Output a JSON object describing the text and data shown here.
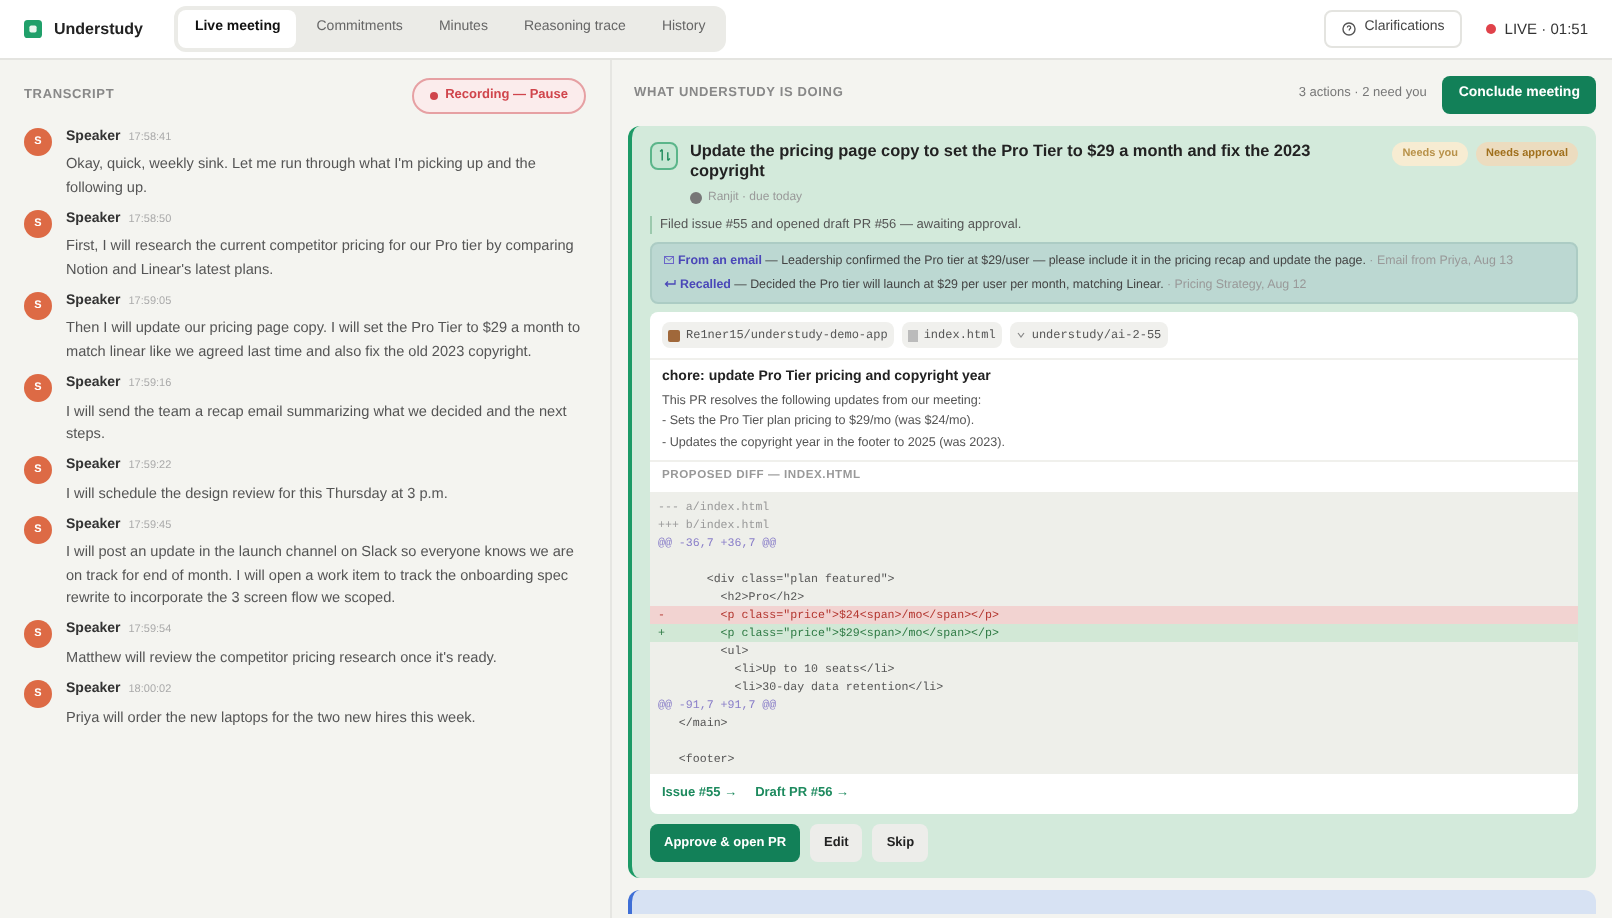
{
  "app": {
    "name": "Understudy"
  },
  "tabs": [
    {
      "label": "Live meeting",
      "selected": true
    },
    {
      "label": "Commitments",
      "selected": false
    },
    {
      "label": "Minutes",
      "selected": false
    },
    {
      "label": "Reasoning trace",
      "selected": false
    },
    {
      "label": "History",
      "selected": false
    }
  ],
  "header": {
    "clarifications": "Clarifications",
    "live": "LIVE · 01:51"
  },
  "transcript": {
    "title": "TRANSCRIPT",
    "recording": "Recording — Pause",
    "entries": [
      {
        "avatar": "S",
        "speaker": "Speaker",
        "time": "17:58:41",
        "text": "Okay, quick, weekly sink. Let me run through what I'm picking up and the following up."
      },
      {
        "avatar": "S",
        "speaker": "Speaker",
        "time": "17:58:50",
        "text": "First, I will research the current competitor pricing for our Pro tier by comparing Notion and Linear's latest plans."
      },
      {
        "avatar": "S",
        "speaker": "Speaker",
        "time": "17:59:05",
        "text": "Then I will update our pricing page copy. I will set the Pro Tier to $29 a month to match linear like we agreed last time and also fix the old 2023 copyright."
      },
      {
        "avatar": "S",
        "speaker": "Speaker",
        "time": "17:59:16",
        "text": "I will send the team a recap email summarizing what we decided and the next steps."
      },
      {
        "avatar": "S",
        "speaker": "Speaker",
        "time": "17:59:22",
        "text": "I will schedule the design review for this Thursday at 3 p.m."
      },
      {
        "avatar": "S",
        "speaker": "Speaker",
        "time": "17:59:45",
        "text": "I will post an update in the launch channel on Slack so everyone knows we are on track for end of month. I will open a work item to track the onboarding spec rewrite to incorporate the 3 screen flow we scoped."
      },
      {
        "avatar": "S",
        "speaker": "Speaker",
        "time": "17:59:54",
        "text": "Matthew will review the competitor pricing research once it's ready."
      },
      {
        "avatar": "S",
        "speaker": "Speaker",
        "time": "18:00:02",
        "text": "Priya will order the new laptops for the two new hires this week."
      }
    ]
  },
  "actions": {
    "title": "WHAT UNDERSTUDY IS DOING",
    "summary": "3 actions · 2 need you",
    "conclude": "Conclude meeting",
    "card": {
      "title": "Update the pricing page copy to set the Pro Tier to $29 a month and fix the 2023 copyright",
      "assignee": "Ranjit · due today",
      "badges": [
        {
          "label": "Needs you",
          "kind": "faded"
        },
        {
          "label": "Needs approval",
          "kind": "approval"
        }
      ],
      "status": "Filed issue #55 and opened draft PR #56 — awaiting approval.",
      "memories": [
        {
          "kind": "email",
          "label": "From an email",
          "text": " — Leadership confirmed the Pro tier at $29/user — please include it in the pricing recap and update the page.",
          "source": " · Email from Priya, Aug 13"
        },
        {
          "kind": "recalled",
          "label": "Recalled",
          "text": " — Decided the Pro tier will launch at $29 per user per month, matching Linear.",
          "source": " · Pricing Strategy, Aug 12"
        }
      ],
      "pr": {
        "repo": "Re1ner15/understudy-demo-app",
        "file": "index.html",
        "branch": "understudy/ai-2-55",
        "title": "chore: update Pro Tier pricing and copyright year",
        "body": [
          "This PR resolves the following updates from our meeting:",
          "- Sets the Pro Tier plan pricing to $29/mo (was $24/mo).",
          "- Updates the copyright year in the footer to 2025 (was 2023)."
        ],
        "diff_title": "PROPOSED DIFF — INDEX.HTML",
        "diff": [
          {
            "kind": "meta",
            "text": "--- a/index.html"
          },
          {
            "kind": "meta",
            "text": "+++ b/index.html"
          },
          {
            "kind": "hunk",
            "text": "@@ -36,7 +36,7 @@"
          },
          {
            "kind": "blank"
          },
          {
            "kind": "context",
            "text": "       <div class=\"plan featured\">"
          },
          {
            "kind": "context",
            "text": "         <h2>Pro</h2>"
          },
          {
            "kind": "del",
            "text": "-        <p class=\"price\">$24<span>/mo</span></p>"
          },
          {
            "kind": "add",
            "text": "+        <p class=\"price\">$29<span>/mo</span></p>"
          },
          {
            "kind": "context",
            "text": "         <ul>"
          },
          {
            "kind": "context",
            "text": "           <li>Up to 10 seats</li>"
          },
          {
            "kind": "context",
            "text": "           <li>30-day data retention</li>"
          },
          {
            "kind": "hunk",
            "text": "@@ -91,7 +91,7 @@"
          },
          {
            "kind": "context",
            "text": "   </main>"
          },
          {
            "kind": "blank"
          },
          {
            "kind": "context",
            "text": "   <footer>"
          }
        ],
        "links": [
          "Issue #55 →",
          "Draft PR #56 →"
        ]
      },
      "buttons": [
        {
          "label": "Approve & open PR",
          "kind": "primary"
        },
        {
          "label": "Edit",
          "kind": "secondary"
        },
        {
          "label": "Skip",
          "kind": "secondary"
        }
      ]
    }
  }
}
